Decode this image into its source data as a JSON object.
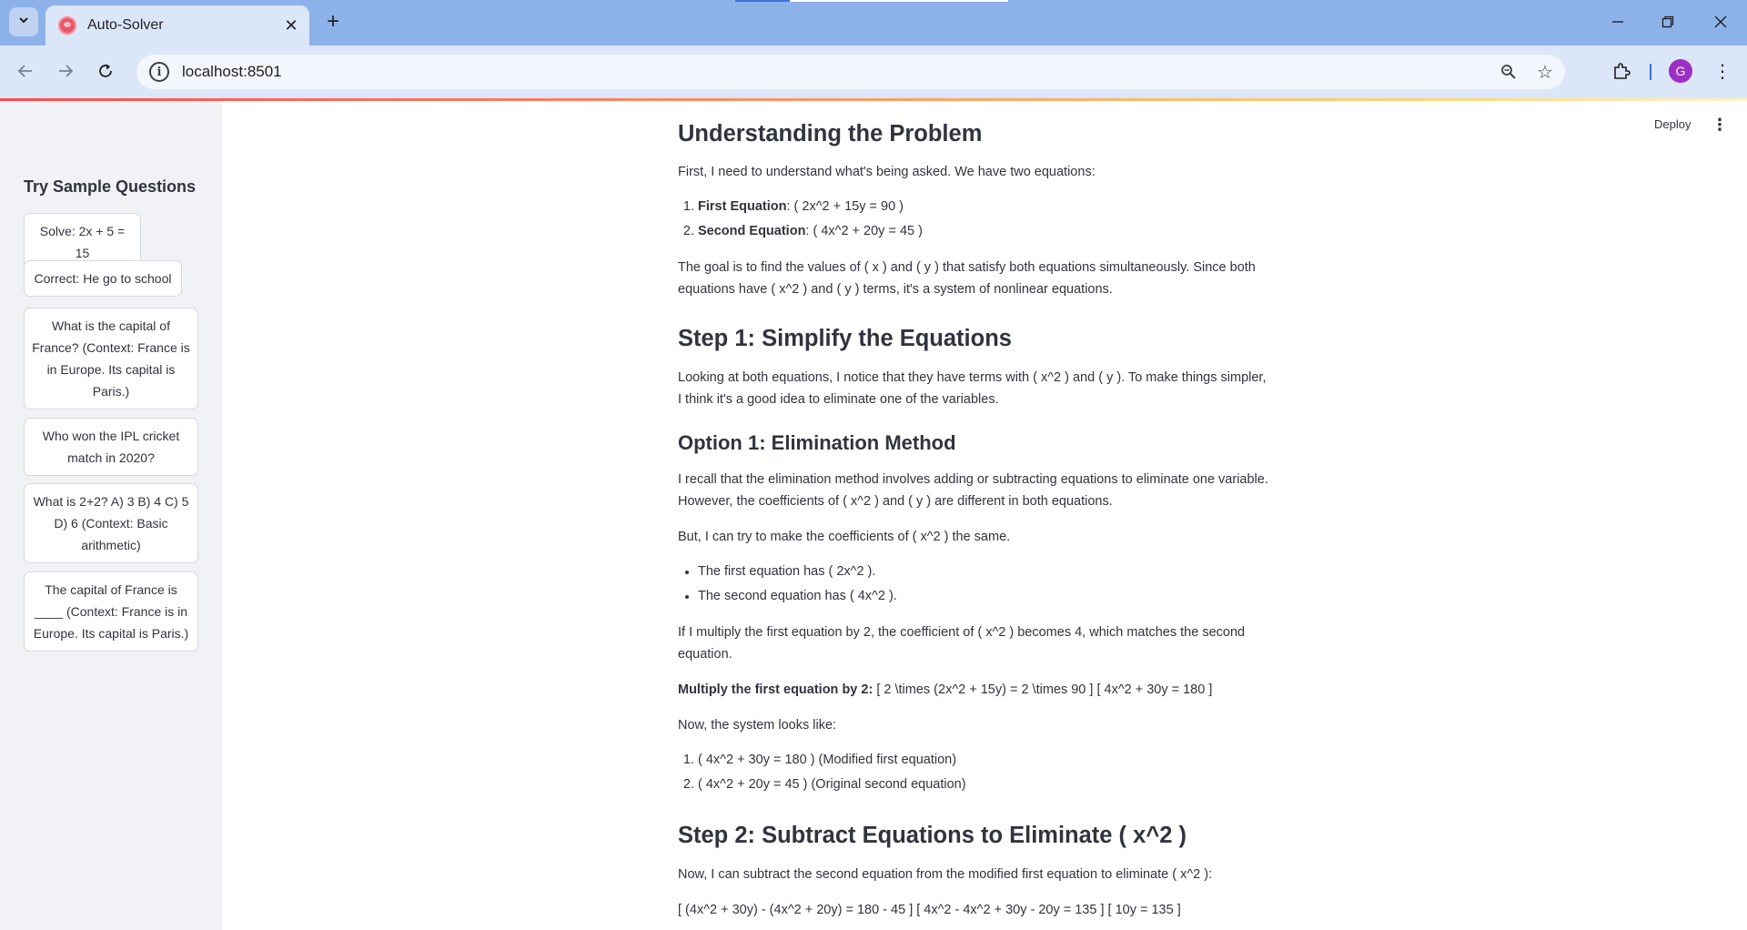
{
  "browser": {
    "tab_title": "Auto-Solver",
    "url": "localhost:8501",
    "avatar_letter": "G"
  },
  "app": {
    "deploy_label": "Deploy",
    "sidebar": {
      "title": "Try Sample Questions",
      "samples": [
        "Solve: 2x + 5 = 15",
        "Correct: He go to school",
        "What is the capital of France? (Context: France is in Europe. Its capital is Paris.)",
        "Who won the IPL cricket match in 2020?",
        "What is 2+2? A) 3 B) 4 C) 5 D) 6 (Context: Basic arithmetic)",
        "The capital of France is ____ (Context: France is in Europe. Its capital is Paris.)"
      ]
    },
    "content": {
      "h_understanding": "Understanding the Problem",
      "p1": "First, I need to understand what's being asked. We have two equations:",
      "eq_list": [
        {
          "label": "First Equation",
          "text": ": ( 2x^2 + 15y = 90 )"
        },
        {
          "label": "Second Equation",
          "text": ": ( 4x^2 + 20y = 45 )"
        }
      ],
      "p2": "The goal is to find the values of ( x ) and ( y ) that satisfy both equations simultaneously. Since both equations have ( x^2 ) and ( y ) terms, it's a system of nonlinear equations.",
      "h_step1": "Step 1: Simplify the Equations",
      "p3": "Looking at both equations, I notice that they have terms with ( x^2 ) and ( y ). To make things simpler, I think it's a good idea to eliminate one of the variables.",
      "h_option1": "Option 1: Elimination Method",
      "p4": "I recall that the elimination method involves adding or subtracting equations to eliminate one variable. However, the coefficients of ( x^2 ) and ( y ) are different in both equations.",
      "p5": "But, I can try to make the coefficients of ( x^2 ) the same.",
      "bullets": [
        "The first equation has ( 2x^2 ).",
        "The second equation has ( 4x^2 )."
      ],
      "p6": "If I multiply the first equation by 2, the coefficient of ( x^2 ) becomes 4, which matches the second equation.",
      "multiply_label": "Multiply the first equation by 2:",
      "multiply_text": " [ 2 \\times (2x^2 + 15y) = 2 \\times 90 ] [ 4x^2 + 30y = 180 ]",
      "p7": "Now, the system looks like:",
      "system_list": [
        "( 4x^2 + 30y = 180 ) (Modified first equation)",
        "( 4x^2 + 20y = 45 ) (Original second equation)"
      ],
      "h_step2": "Step 2: Subtract Equations to Eliminate ( x^2 )",
      "p8": "Now, I can subtract the second equation from the modified first equation to eliminate ( x^2 ):",
      "p9": "[ (4x^2 + 30y) - (4x^2 + 20y) = 180 - 45 ] [ 4x^2 - 4x^2 + 30y - 20y = 135 ] [ 10y = 135 ]"
    }
  }
}
